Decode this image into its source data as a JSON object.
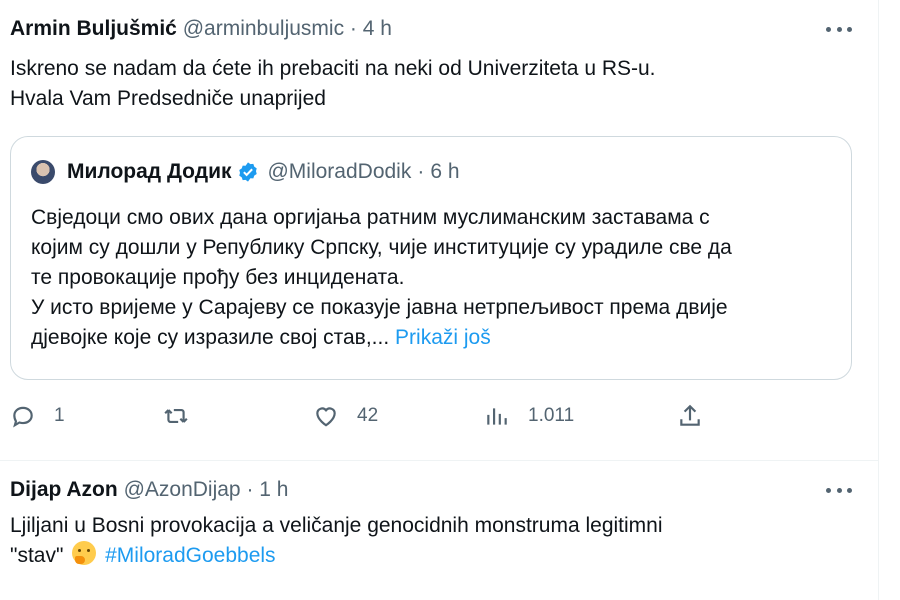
{
  "tweets": [
    {
      "author_name": "Armin Buljušmić",
      "handle": "@arminbuljusmic",
      "separator": "·",
      "time": "4 h",
      "text_lines": [
        "Iskreno se nadam da ćete ih prebaciti na neki od Univerziteta u RS-u.",
        "Hvala Vam Predsedniče unaprijed"
      ],
      "quote": {
        "author_name": "Милорад Додик",
        "handle": "@MiloradDodik",
        "separator": "·",
        "time": "6 h",
        "verified": true,
        "text_lines": [
          "Свједоци смо ових дана оргијања ратним муслиманским заставама с",
          "којим су дошли у Републику Српску, чије институције су урадиле све да",
          "те провокације прођу без инцидената.",
          "У исто вријеме у Сарајеву се показује јавна нетрпељивост према двије"
        ],
        "last_line": "дјевојке које су изразиле свој став,...",
        "show_more": "Prikaži još"
      },
      "actions": {
        "reply_count": "1",
        "retweet_count": "",
        "like_count": "42",
        "views_count": "1.011"
      }
    },
    {
      "author_name": "Dijap Azon",
      "handle": "@AzonDijap",
      "separator": "·",
      "time": "1 h",
      "text_line1": "Ljiljani u Bosni provokacija a veličanje genocidnih monstruma legitimni",
      "text_line2_prefix": "\"stav\"",
      "emoji": "thinking-face",
      "hashtag": "#MiloradGoebbels"
    }
  ],
  "colors": {
    "text": "#0f1419",
    "secondary": "#536471",
    "link": "#1d9bf0",
    "border": "#cfd9de"
  }
}
